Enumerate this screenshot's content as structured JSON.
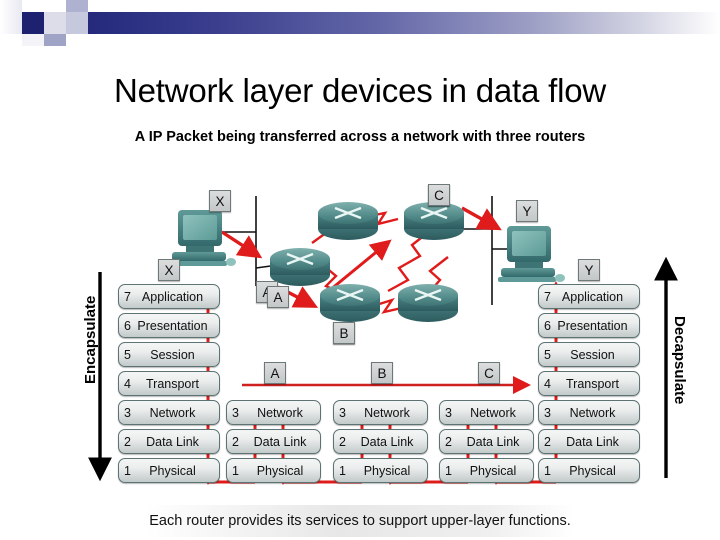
{
  "header": {
    "title": "Network layer devices in data flow",
    "subtitle": "A IP Packet being transferred across a network with three routers"
  },
  "caption": "Each router provides its services to support upper-layer functions.",
  "side_labels": {
    "left": "Encapsulate",
    "right": "Decapsulate"
  },
  "colors": {
    "deco_dark": "#1d2170",
    "deco_mid": "#6468a8",
    "deco_light": "#c6c8de",
    "path_red": "#e01b1b",
    "device_teal": "#4f8a8b",
    "box_border": "#5d7273",
    "text": "#111111"
  },
  "topology": {
    "host_left": {
      "label": "X",
      "icon": "desktop-computer-icon"
    },
    "host_right": {
      "label": "Y",
      "icon": "desktop-computer-icon"
    },
    "routers": [
      {
        "id": "r-a",
        "label": "A",
        "icon": "router-icon"
      },
      {
        "id": "r-top",
        "label": "",
        "icon": "router-icon"
      },
      {
        "id": "r-b",
        "label": "B",
        "icon": "router-icon"
      },
      {
        "id": "r-low",
        "label": "",
        "icon": "router-icon"
      },
      {
        "id": "r-c",
        "label": "C",
        "icon": "router-icon"
      }
    ]
  },
  "flow_arrow_labels": [
    "A",
    "B",
    "C"
  ],
  "stacks": {
    "host_left": {
      "label": "X",
      "layers": [
        {
          "num": "7",
          "name": "Application"
        },
        {
          "num": "6",
          "name": "Presentation"
        },
        {
          "num": "5",
          "name": "Session"
        },
        {
          "num": "4",
          "name": "Transport"
        },
        {
          "num": "3",
          "name": "Network"
        },
        {
          "num": "2",
          "name": "Data Link"
        },
        {
          "num": "1",
          "name": "Physical"
        }
      ]
    },
    "host_right": {
      "label": "Y",
      "layers": [
        {
          "num": "7",
          "name": "Application"
        },
        {
          "num": "6",
          "name": "Presentation"
        },
        {
          "num": "5",
          "name": "Session"
        },
        {
          "num": "4",
          "name": "Transport"
        },
        {
          "num": "3",
          "name": "Network"
        },
        {
          "num": "2",
          "name": "Data Link"
        },
        {
          "num": "1",
          "name": "Physical"
        }
      ]
    },
    "router_a": {
      "label": "A",
      "layers": [
        {
          "num": "3",
          "name": "Network"
        },
        {
          "num": "2",
          "name": "Data Link"
        },
        {
          "num": "1",
          "name": "Physical"
        }
      ]
    },
    "router_b": {
      "label": "B",
      "layers": [
        {
          "num": "3",
          "name": "Network"
        },
        {
          "num": "2",
          "name": "Data Link"
        },
        {
          "num": "1",
          "name": "Physical"
        }
      ]
    },
    "router_c": {
      "label": "C",
      "layers": [
        {
          "num": "3",
          "name": "Network"
        },
        {
          "num": "2",
          "name": "Data Link"
        },
        {
          "num": "1",
          "name": "Physical"
        }
      ]
    }
  }
}
